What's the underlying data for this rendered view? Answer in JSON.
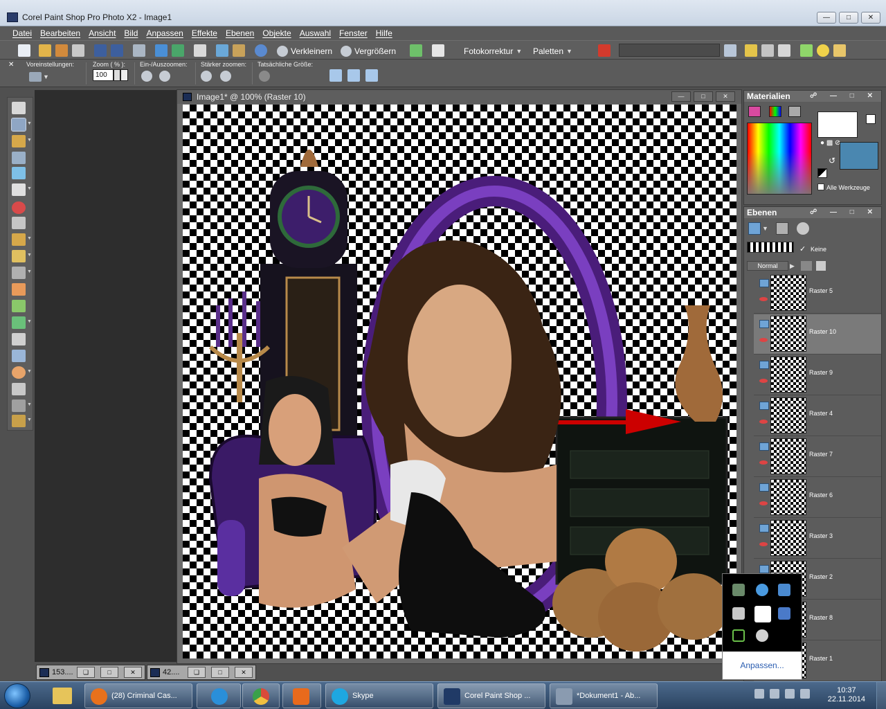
{
  "window": {
    "title": "Corel Paint Shop Pro Photo X2 - Image1"
  },
  "menu": [
    "Datei",
    "Bearbeiten",
    "Ansicht",
    "Bild",
    "Anpassen",
    "Effekte",
    "Ebenen",
    "Objekte",
    "Auswahl",
    "Fenster",
    "Hilfe"
  ],
  "toolbar": {
    "zoom_out_label": "Verkleinern",
    "zoom_in_label": "Vergrößern",
    "photo_fix_label": "Fotokorrektur",
    "palettes_label": "Paletten"
  },
  "options": {
    "presets_label": "Voreinstellungen:",
    "zoom_label": "Zoom ( % ):",
    "zoom_value": "100",
    "inout_label": "Ein-/Auszoomen:",
    "more_zoom_label": "Stärker zoomen:",
    "actual_size_label": "Tatsächliche Größe:"
  },
  "image_window": {
    "title": "Image1* @ 100% (Raster 10)"
  },
  "materials": {
    "title": "Materialien",
    "all_tools_label": "Alle Werkzeuge"
  },
  "layers": {
    "title": "Ebenen",
    "blend_mode": "Normal",
    "mask_label": "Keine",
    "items": [
      {
        "name": "Raster 5",
        "selected": false
      },
      {
        "name": "Raster 10",
        "selected": true
      },
      {
        "name": "Raster 9",
        "selected": false
      },
      {
        "name": "Raster 4",
        "selected": false
      },
      {
        "name": "Raster 7",
        "selected": false
      },
      {
        "name": "Raster 6",
        "selected": false
      },
      {
        "name": "Raster 3",
        "selected": false
      },
      {
        "name": "Raster 2",
        "selected": false
      },
      {
        "name": "Raster 8",
        "selected": false
      },
      {
        "name": "Raster 1",
        "selected": false
      }
    ]
  },
  "popup": {
    "customize_label": "Anpassen..."
  },
  "minimized_docs": [
    {
      "name": "153...."
    },
    {
      "name": "42...."
    }
  ],
  "taskbar": {
    "buttons": [
      {
        "label": "(28) Criminal Cas...",
        "color": "#e8711c"
      },
      {
        "label": "",
        "color": "#2a8fd9"
      },
      {
        "label": "",
        "color": "#d94a3a"
      },
      {
        "label": "",
        "color": "#e86a1c"
      },
      {
        "label": "Skype",
        "color": "#1ea7e1"
      },
      {
        "label": "Corel Paint Shop ...",
        "color": "#203a66"
      },
      {
        "label": "*Dokument1 - Ab...",
        "color": "#8a9bb0"
      }
    ],
    "time": "10:37",
    "date": "22.11.2014"
  }
}
